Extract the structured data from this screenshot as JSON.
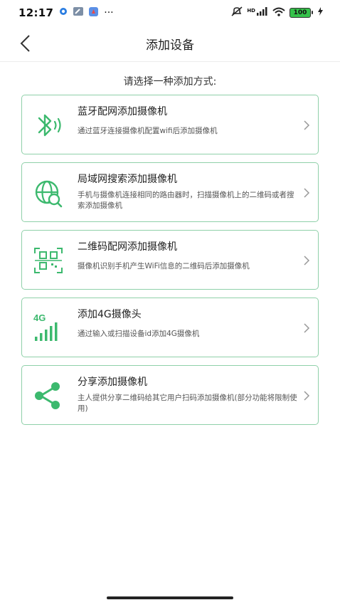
{
  "status_bar": {
    "time": "12:17",
    "more": "···",
    "hd": "HD",
    "battery": "100"
  },
  "header": {
    "title": "添加设备"
  },
  "prompt": "请选择一种添加方式:",
  "colors": {
    "accent": "#3cb96e",
    "card_border": "#8fd0a9"
  },
  "options": [
    {
      "title": "蓝牙配网添加摄像机",
      "desc": "通过蓝牙连接摄像机配置wifi后添加摄像机",
      "icon": "bluetooth-icon"
    },
    {
      "title": "局域网搜索添加摄像机",
      "desc": "手机与摄像机连接相同的路由器时，扫描摄像机上的二维码或者搜索添加摄像机",
      "icon": "lan-search-icon"
    },
    {
      "title": "二维码配网添加摄像机",
      "desc": "摄像机识别手机产生WiFi信息的二维码后添加摄像机",
      "icon": "qr-code-icon"
    },
    {
      "title": "添加4G摄像头",
      "desc": "通过输入或扫描设备id添加4G摄像机",
      "icon": "4g-signal-icon",
      "icon_text": "4G"
    },
    {
      "title": "分享添加摄像机",
      "desc": "主人提供分享二维码给其它用户扫码添加摄像机(部分功能将限制使用)",
      "icon": "share-icon"
    }
  ]
}
